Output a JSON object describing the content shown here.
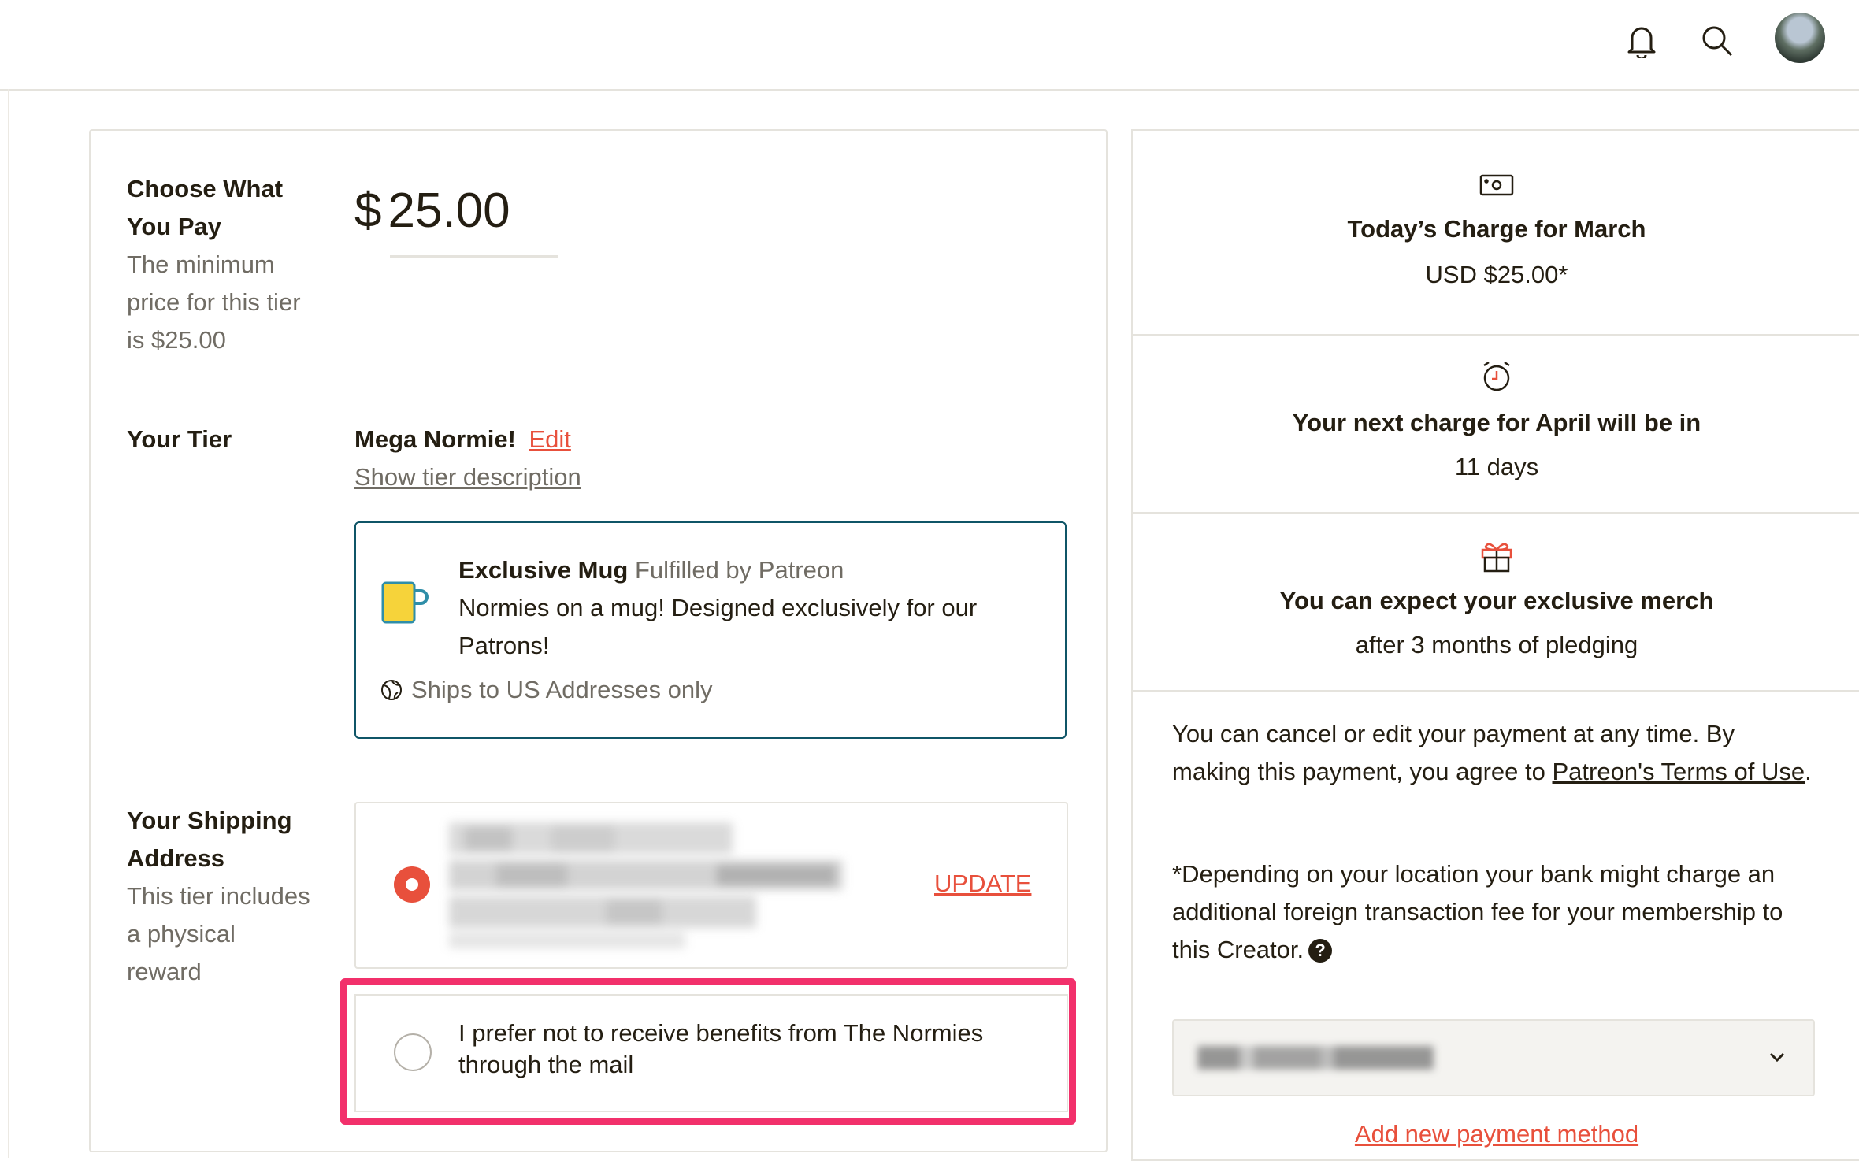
{
  "header": {
    "icons": [
      "bell-icon",
      "search-icon",
      "avatar"
    ]
  },
  "pricing": {
    "label": "Choose What You Pay",
    "sublabel": "The minimum price for this tier is $25.00",
    "currency": "$",
    "amount": "25.00"
  },
  "tier": {
    "label": "Your Tier",
    "name": "Mega Normie!",
    "edit": "Edit",
    "show_description": "Show tier description",
    "benefit": {
      "title": "Exclusive Mug",
      "fulfilled": "Fulfilled by Patreon",
      "description": "Normies on a mug! Designed exclusively for our Patrons!",
      "ships": "Ships to US Addresses only",
      "icon": "mug-icon"
    }
  },
  "shipping": {
    "label": "Your Shipping Address",
    "sublabel": "This tier includes a physical reward",
    "update": "UPDATE",
    "opt_out": "I prefer not to receive benefits from The Normies through the mail"
  },
  "summary": {
    "charge_title": "Today’s Charge for March",
    "charge_amount": "USD $25.00*",
    "next_title": "Your next charge for April will be in",
    "next_value": "11 days",
    "merch_title": "You can expect your exclusive merch",
    "merch_value": "after 3 months of pledging",
    "cancel_text": "You can cancel or edit your payment at any time. By making this payment, you agree to",
    "terms_link": "Patreon's Terms of Use",
    "period": ".",
    "fee_note": "*Depending on your location your bank might charge an additional foreign transaction fee for your membership to this Creator.",
    "qmark": "?",
    "add_payment": "Add new payment method"
  },
  "colors": {
    "accent": "#e8503c",
    "benefit_border": "#0f5567",
    "highlight": "#f2306b",
    "text": "#241e12",
    "muted": "#706c64"
  }
}
